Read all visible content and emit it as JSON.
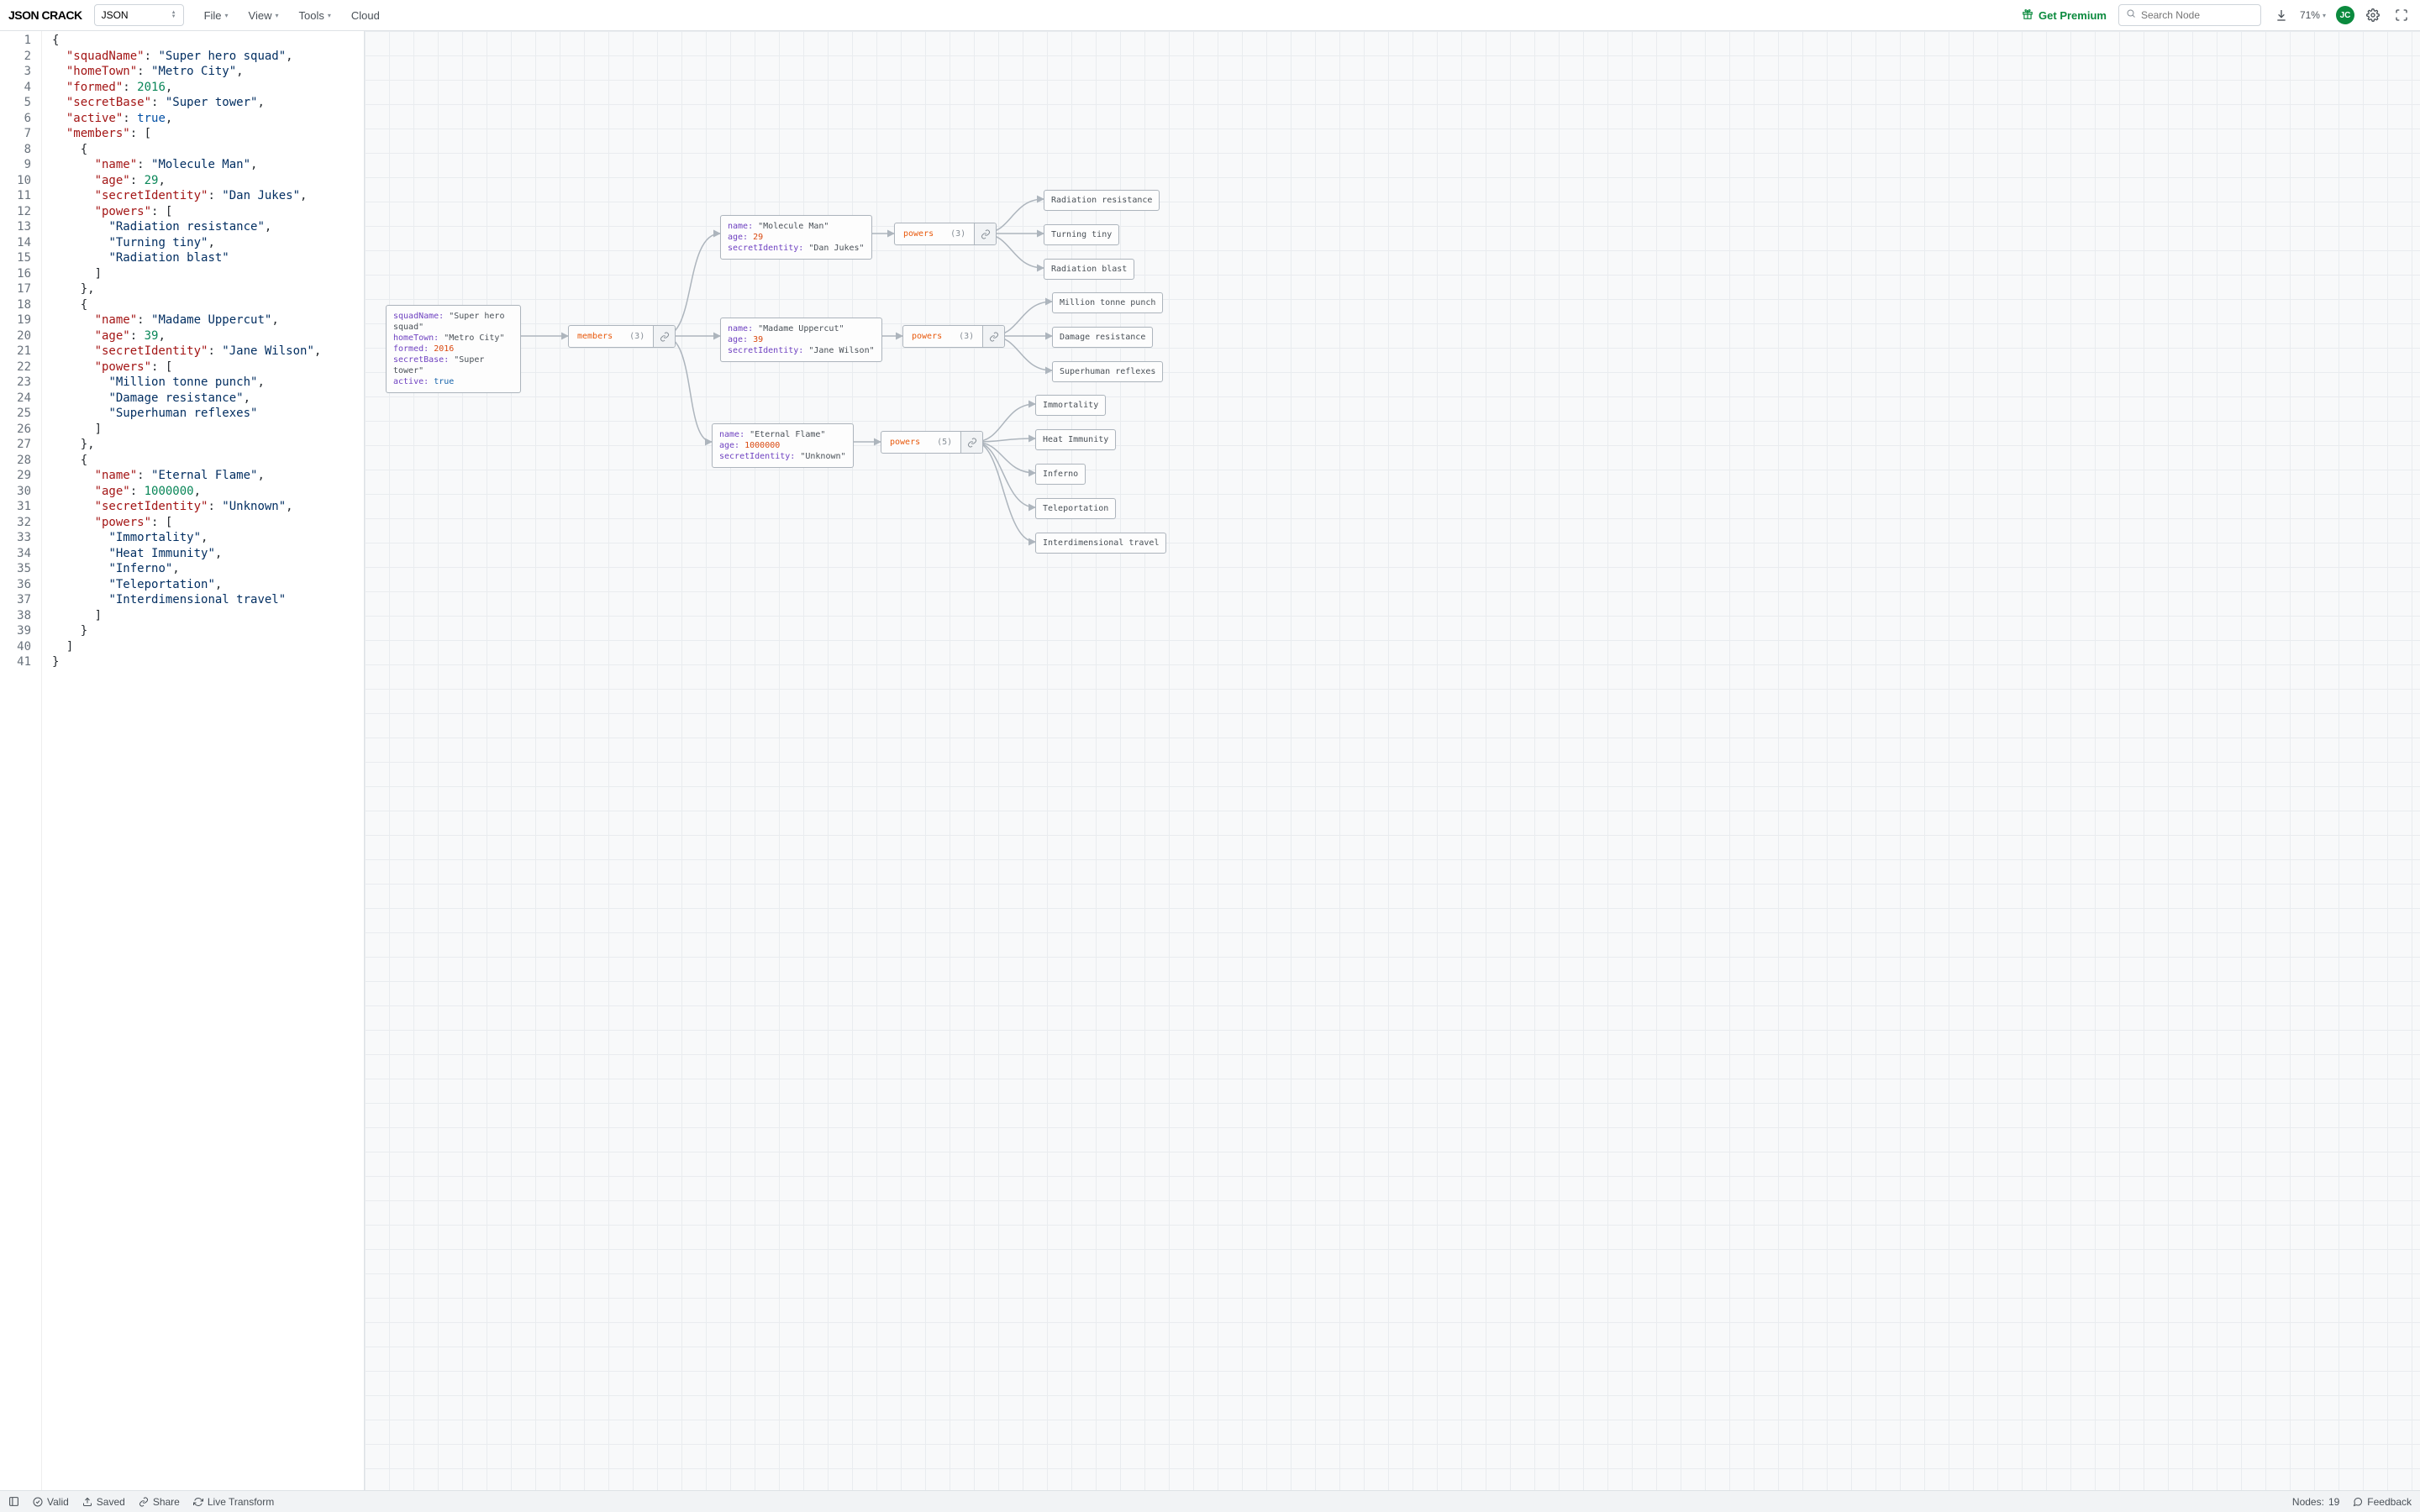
{
  "brand": "JSON CRACK",
  "format_select": "JSON",
  "menus": {
    "file": "File",
    "view": "View",
    "tools": "Tools",
    "cloud": "Cloud"
  },
  "premium_label": "Get Premium",
  "search_placeholder": "Search Node",
  "zoom_label": "71%",
  "avatar_initials": "JC",
  "status": {
    "valid": "Valid",
    "saved": "Saved",
    "share": "Share",
    "live_transform": "Live Transform",
    "nodes_label": "Nodes:",
    "nodes_count": "19",
    "feedback": "Feedback"
  },
  "code_lines": [
    [
      [
        "p",
        "{"
      ]
    ],
    [
      [
        "p",
        "  "
      ],
      [
        "key",
        "\"squadName\""
      ],
      [
        "p",
        ": "
      ],
      [
        "str",
        "\"Super hero squad\""
      ],
      [
        "p",
        ","
      ]
    ],
    [
      [
        "p",
        "  "
      ],
      [
        "key",
        "\"homeTown\""
      ],
      [
        "p",
        ": "
      ],
      [
        "str",
        "\"Metro City\""
      ],
      [
        "p",
        ","
      ]
    ],
    [
      [
        "p",
        "  "
      ],
      [
        "key",
        "\"formed\""
      ],
      [
        "p",
        ": "
      ],
      [
        "num",
        "2016"
      ],
      [
        "p",
        ","
      ]
    ],
    [
      [
        "p",
        "  "
      ],
      [
        "key",
        "\"secretBase\""
      ],
      [
        "p",
        ": "
      ],
      [
        "str",
        "\"Super tower\""
      ],
      [
        "p",
        ","
      ]
    ],
    [
      [
        "p",
        "  "
      ],
      [
        "key",
        "\"active\""
      ],
      [
        "p",
        ": "
      ],
      [
        "bool",
        "true"
      ],
      [
        "p",
        ","
      ]
    ],
    [
      [
        "p",
        "  "
      ],
      [
        "key",
        "\"members\""
      ],
      [
        "p",
        ": ["
      ]
    ],
    [
      [
        "p",
        "    {"
      ]
    ],
    [
      [
        "p",
        "      "
      ],
      [
        "key",
        "\"name\""
      ],
      [
        "p",
        ": "
      ],
      [
        "str",
        "\"Molecule Man\""
      ],
      [
        "p",
        ","
      ]
    ],
    [
      [
        "p",
        "      "
      ],
      [
        "key",
        "\"age\""
      ],
      [
        "p",
        ": "
      ],
      [
        "num",
        "29"
      ],
      [
        "p",
        ","
      ]
    ],
    [
      [
        "p",
        "      "
      ],
      [
        "key",
        "\"secretIdentity\""
      ],
      [
        "p",
        ": "
      ],
      [
        "str",
        "\"Dan Jukes\""
      ],
      [
        "p",
        ","
      ]
    ],
    [
      [
        "p",
        "      "
      ],
      [
        "key",
        "\"powers\""
      ],
      [
        "p",
        ": ["
      ]
    ],
    [
      [
        "p",
        "        "
      ],
      [
        "str",
        "\"Radiation resistance\""
      ],
      [
        "p",
        ","
      ]
    ],
    [
      [
        "p",
        "        "
      ],
      [
        "str",
        "\"Turning tiny\""
      ],
      [
        "p",
        ","
      ]
    ],
    [
      [
        "p",
        "        "
      ],
      [
        "str",
        "\"Radiation blast\""
      ]
    ],
    [
      [
        "p",
        "      ]"
      ]
    ],
    [
      [
        "p",
        "    },"
      ]
    ],
    [
      [
        "p",
        "    {"
      ]
    ],
    [
      [
        "p",
        "      "
      ],
      [
        "key",
        "\"name\""
      ],
      [
        "p",
        ": "
      ],
      [
        "str",
        "\"Madame Uppercut\""
      ],
      [
        "p",
        ","
      ]
    ],
    [
      [
        "p",
        "      "
      ],
      [
        "key",
        "\"age\""
      ],
      [
        "p",
        ": "
      ],
      [
        "num",
        "39"
      ],
      [
        "p",
        ","
      ]
    ],
    [
      [
        "p",
        "      "
      ],
      [
        "key",
        "\"secretIdentity\""
      ],
      [
        "p",
        ": "
      ],
      [
        "str",
        "\"Jane Wilson\""
      ],
      [
        "p",
        ","
      ]
    ],
    [
      [
        "p",
        "      "
      ],
      [
        "key",
        "\"powers\""
      ],
      [
        "p",
        ": ["
      ]
    ],
    [
      [
        "p",
        "        "
      ],
      [
        "str",
        "\"Million tonne punch\""
      ],
      [
        "p",
        ","
      ]
    ],
    [
      [
        "p",
        "        "
      ],
      [
        "str",
        "\"Damage resistance\""
      ],
      [
        "p",
        ","
      ]
    ],
    [
      [
        "p",
        "        "
      ],
      [
        "str",
        "\"Superhuman reflexes\""
      ]
    ],
    [
      [
        "p",
        "      ]"
      ]
    ],
    [
      [
        "p",
        "    },"
      ]
    ],
    [
      [
        "p",
        "    {"
      ]
    ],
    [
      [
        "p",
        "      "
      ],
      [
        "key",
        "\"name\""
      ],
      [
        "p",
        ": "
      ],
      [
        "str",
        "\"Eternal Flame\""
      ],
      [
        "p",
        ","
      ]
    ],
    [
      [
        "p",
        "      "
      ],
      [
        "key",
        "\"age\""
      ],
      [
        "p",
        ": "
      ],
      [
        "num",
        "1000000"
      ],
      [
        "p",
        ","
      ]
    ],
    [
      [
        "p",
        "      "
      ],
      [
        "key",
        "\"secretIdentity\""
      ],
      [
        "p",
        ": "
      ],
      [
        "str",
        "\"Unknown\""
      ],
      [
        "p",
        ","
      ]
    ],
    [
      [
        "p",
        "      "
      ],
      [
        "key",
        "\"powers\""
      ],
      [
        "p",
        ": ["
      ]
    ],
    [
      [
        "p",
        "        "
      ],
      [
        "str",
        "\"Immortality\""
      ],
      [
        "p",
        ","
      ]
    ],
    [
      [
        "p",
        "        "
      ],
      [
        "str",
        "\"Heat Immunity\""
      ],
      [
        "p",
        ","
      ]
    ],
    [
      [
        "p",
        "        "
      ],
      [
        "str",
        "\"Inferno\""
      ],
      [
        "p",
        ","
      ]
    ],
    [
      [
        "p",
        "        "
      ],
      [
        "str",
        "\"Teleportation\""
      ],
      [
        "p",
        ","
      ]
    ],
    [
      [
        "p",
        "        "
      ],
      [
        "str",
        "\"Interdimensional travel\""
      ]
    ],
    [
      [
        "p",
        "      ]"
      ]
    ],
    [
      [
        "p",
        "    }"
      ]
    ],
    [
      [
        "p",
        "  ]"
      ]
    ],
    [
      [
        "p",
        "}"
      ]
    ]
  ],
  "graph": {
    "root": {
      "squadName": "\"Super hero squad\"",
      "homeTown": "\"Metro City\"",
      "formed": "2016",
      "secretBase": "\"Super tower\"",
      "active": "true"
    },
    "members_label": "members",
    "members_count": "(3)",
    "members": [
      {
        "name": "\"Molecule Man\"",
        "age": "29",
        "secretIdentity": "\"Dan Jukes\"",
        "powers_label": "powers",
        "powers_count": "(3)",
        "powers": [
          "Radiation resistance",
          "Turning tiny",
          "Radiation blast"
        ]
      },
      {
        "name": "\"Madame Uppercut\"",
        "age": "39",
        "secretIdentity": "\"Jane Wilson\"",
        "powers_label": "powers",
        "powers_count": "(3)",
        "powers": [
          "Million tonne punch",
          "Damage resistance",
          "Superhuman reflexes"
        ]
      },
      {
        "name": "\"Eternal Flame\"",
        "age": "1000000",
        "secretIdentity": "\"Unknown\"",
        "powers_label": "powers",
        "powers_count": "(5)",
        "powers": [
          "Immortality",
          "Heat Immunity",
          "Inferno",
          "Teleportation",
          "Interdimensional travel"
        ]
      }
    ]
  }
}
